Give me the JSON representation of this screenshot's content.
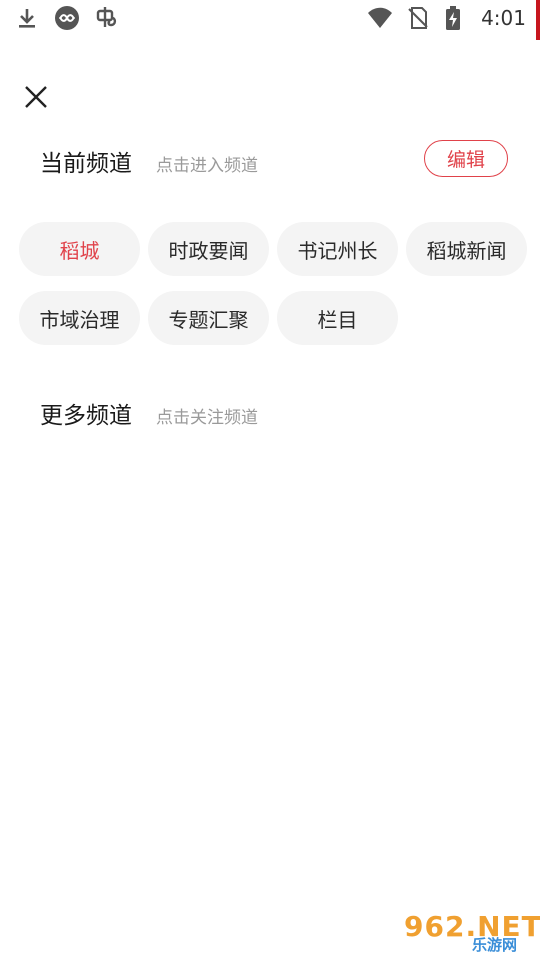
{
  "status_bar": {
    "time": "4:01",
    "left_icons": [
      "download-icon",
      "infinity-app-icon",
      "bug-app-icon"
    ],
    "right_icons": [
      "wifi-icon",
      "no-sim-icon",
      "battery-charging-icon"
    ],
    "accent_color": "#c7161e"
  },
  "close_icon": "close-icon",
  "current_section": {
    "title": "当前频道",
    "hint": "点击进入频道",
    "edit_label": "编辑"
  },
  "current_channels": [
    {
      "label": "稻城",
      "active": true
    },
    {
      "label": "时政要闻",
      "active": false
    },
    {
      "label": "书记州长",
      "active": false
    },
    {
      "label": "稻城新闻",
      "active": false
    },
    {
      "label": "市域治理",
      "active": false
    },
    {
      "label": "专题汇聚",
      "active": false
    },
    {
      "label": "栏目",
      "active": false
    }
  ],
  "more_section": {
    "title": "更多频道",
    "hint": "点击关注频道"
  },
  "colors": {
    "accent": "#e0424a",
    "chip_bg": "#f4f4f4",
    "hint_text": "#9a9a9a"
  },
  "watermark": {
    "big": "962.NET",
    "small": "乐游网"
  }
}
